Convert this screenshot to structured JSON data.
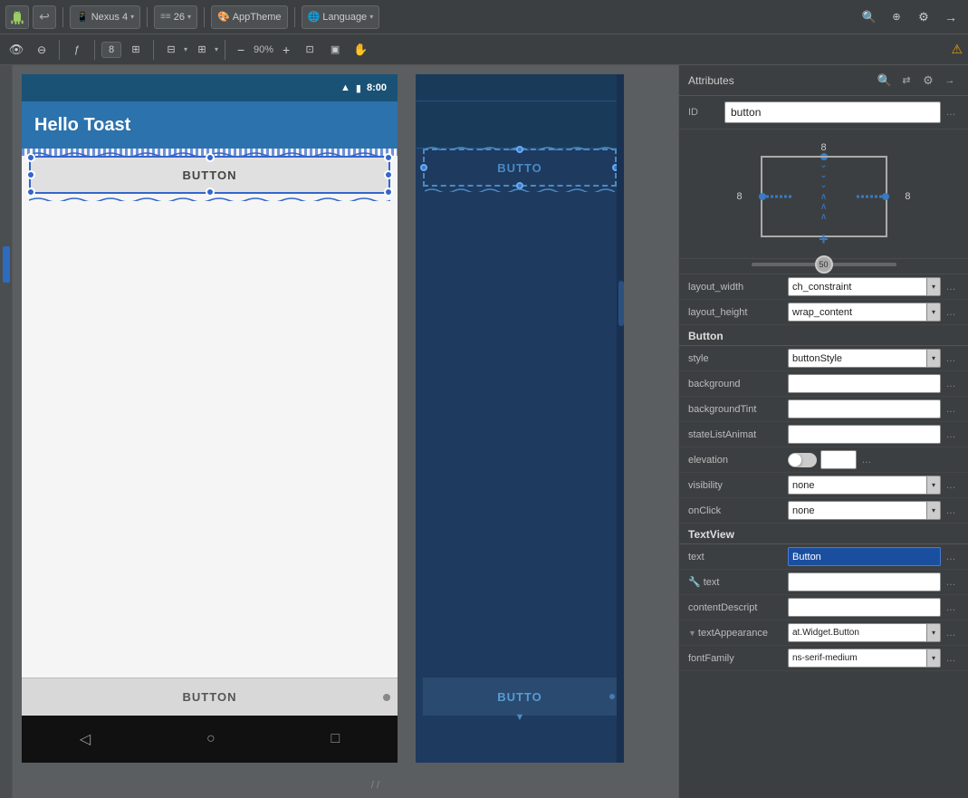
{
  "toolbar": {
    "title": "Nexus",
    "device_label": "Nexus 4",
    "api_label": "26",
    "theme_label": "AppTheme",
    "language_label": "Language",
    "device_icon": "📱",
    "chevron": "▾",
    "zoom_label": "90%",
    "warning_icon": "⚠",
    "second_toolbar": {
      "number": "8",
      "zoom_minus": "−",
      "zoom_value": "90%",
      "zoom_plus": "+"
    }
  },
  "canvas": {
    "phone1": {
      "status_bar": {
        "wifi": "▲",
        "battery": "🔋",
        "time": "8:00"
      },
      "app_title": "Hello Toast",
      "button_label": "BUTTON",
      "bottom_button_label": "BUTTON"
    },
    "phone2": {
      "button_label": "BUTTO",
      "bottom_button_label": "BUTTO"
    }
  },
  "attributes_panel": {
    "title": "Attributes",
    "id_label": "ID",
    "id_value": "button",
    "constraint_numbers": {
      "top": "8",
      "left": "8",
      "right": "8"
    },
    "slider_value": "50",
    "layout_width_label": "layout_width",
    "layout_width_value": "ch_constraint",
    "layout_height_label": "layout_height",
    "layout_height_value": "wrap_content",
    "sections": {
      "button": {
        "header": "Button",
        "rows": [
          {
            "label": "style",
            "value": "buttonStyle",
            "type": "select"
          },
          {
            "label": "background",
            "value": "",
            "type": "input"
          },
          {
            "label": "backgroundTint",
            "value": "",
            "type": "input"
          },
          {
            "label": "stateListAnimat",
            "value": "",
            "type": "input"
          },
          {
            "label": "elevation",
            "value": "",
            "type": "elevation"
          },
          {
            "label": "visibility",
            "value": "none",
            "type": "select"
          },
          {
            "label": "onClick",
            "value": "none",
            "type": "select"
          }
        ]
      },
      "textview": {
        "header": "TextView",
        "rows": [
          {
            "label": "text",
            "value": "Button",
            "type": "input-highlight"
          },
          {
            "label": "text (wrench)",
            "value": "",
            "type": "input"
          },
          {
            "label": "contentDescript",
            "value": "",
            "type": "input"
          },
          {
            "label": "textAppearance",
            "value": "at.Widget.Button",
            "type": "select"
          },
          {
            "label": "fontFamily",
            "value": "ns-serif-medium",
            "type": "select"
          }
        ]
      }
    }
  }
}
